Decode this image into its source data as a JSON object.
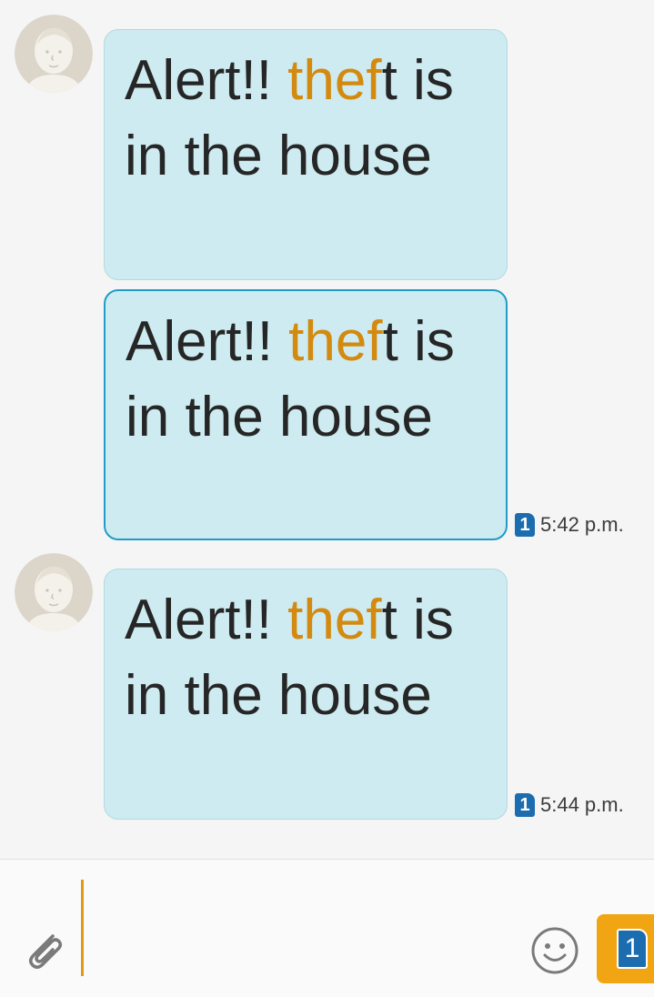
{
  "messages": [
    {
      "text_before": "Alert!! ",
      "highlight": "thef",
      "text_after": "t is in the house",
      "show_avatar": true,
      "selected": false,
      "time": "",
      "sim": ""
    },
    {
      "text_before": "Alert!! ",
      "highlight": "thef",
      "text_after": "t is in the house",
      "show_avatar": false,
      "selected": true,
      "time": "5:42 p.m.",
      "sim": "1"
    },
    {
      "text_before": "Alert!! ",
      "highlight": "thef",
      "text_after": "t is in the house",
      "show_avatar": true,
      "selected": false,
      "time": "5:44 p.m.",
      "sim": "1"
    }
  ],
  "composer": {
    "input_value": "",
    "attach_icon": "paperclip-icon",
    "emoji_icon": "smiley-icon",
    "send_sim": "1"
  },
  "colors": {
    "bubble_bg": "#cdebf0",
    "highlight": "#d4890f",
    "selected_border": "#1f9cc7",
    "sim_badge": "#1c6cb0",
    "send_button": "#f2a512"
  }
}
